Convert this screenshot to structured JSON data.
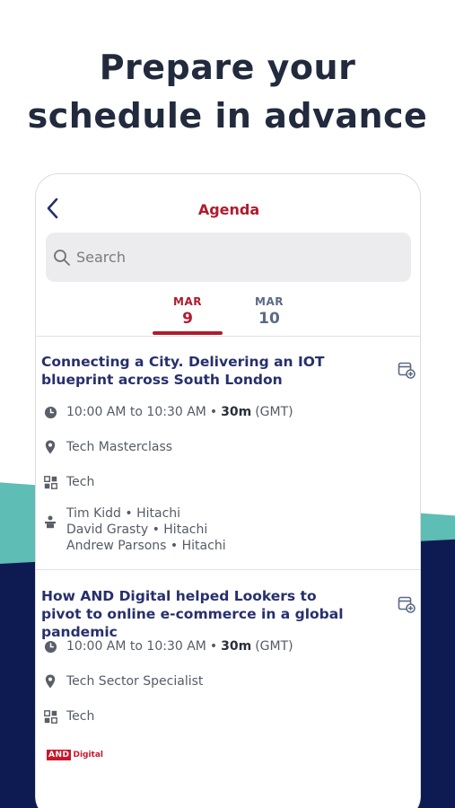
{
  "headline": {
    "line1": "Prepare your",
    "line2": "schedule in advance"
  },
  "screen": {
    "title": "Agenda",
    "search_placeholder": "Search",
    "date_tabs": [
      {
        "month": "MAR",
        "day": "9",
        "active": true
      },
      {
        "month": "MAR",
        "day": "10",
        "active": false
      }
    ]
  },
  "sessions": [
    {
      "title": "Connecting a City. Delivering an IOT blueprint across South London",
      "time": "10:00 AM to 10:30 AM",
      "duration": "30m",
      "timezone": "(GMT)",
      "location": "Tech Masterclass",
      "track": "Tech",
      "speakers": [
        "Tim  Kidd • Hitachi",
        "David  Grasty • Hitachi",
        "Andrew  Parsons • Hitachi"
      ]
    },
    {
      "title": "How AND Digital helped Lookers to pivot to online e-commerce in a global pandemic",
      "time": "10:00 AM to 10:30 AM",
      "duration": "30m",
      "timezone": "(GMT)",
      "location": "Tech Sector Specialist",
      "track": "Tech",
      "sponsor_logo": {
        "mark": "AND",
        "text": "Digital"
      }
    }
  ],
  "separator": "•",
  "icons": {
    "back": "chevron-left-icon",
    "search": "search-icon",
    "add_calendar": "calendar-add-icon",
    "clock": "clock-icon",
    "location": "map-pin-icon",
    "track": "grid-icon",
    "speaker": "podium-icon"
  },
  "colors": {
    "accent": "#b01b2e",
    "title_navy": "#27306b",
    "teal": "#5ebdb4",
    "navy": "#0e1a52"
  }
}
